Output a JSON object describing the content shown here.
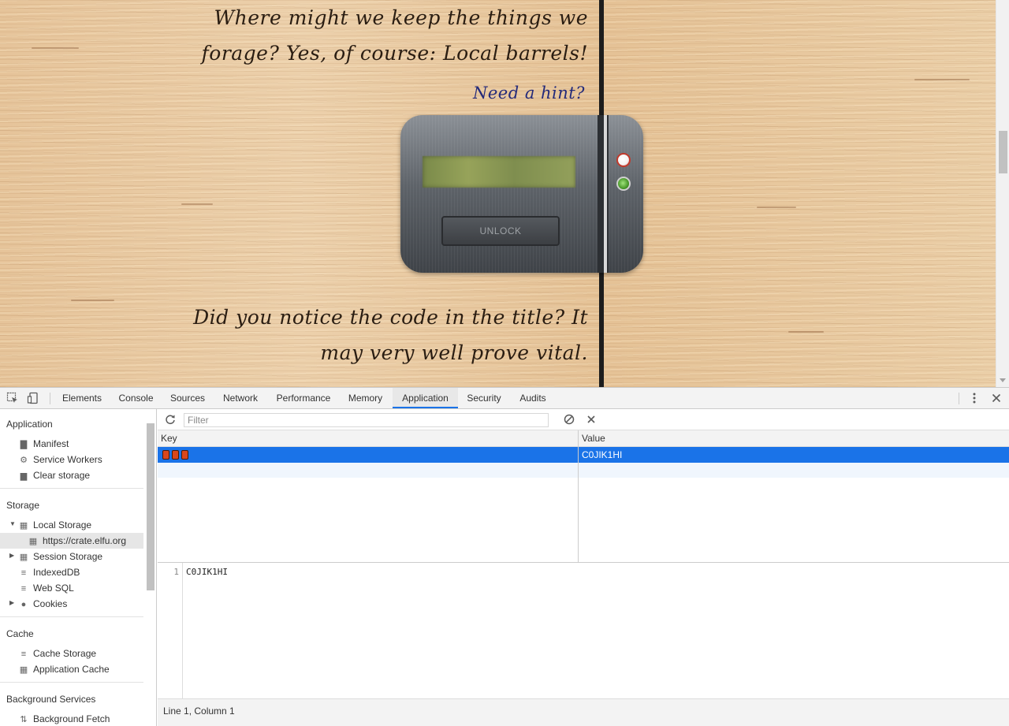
{
  "page": {
    "text_line_1": "Where might we keep the things we",
    "text_line_2": "forage? Yes, of course: Local barrels!",
    "hint_link": "Need a hint?",
    "text_line_3": "Did you notice the code in the title? It",
    "text_line_4": "may very well prove vital.",
    "unlock_button": "UNLOCK"
  },
  "devtools": {
    "tabs": [
      {
        "label": "Elements"
      },
      {
        "label": "Console"
      },
      {
        "label": "Sources"
      },
      {
        "label": "Network"
      },
      {
        "label": "Performance"
      },
      {
        "label": "Memory"
      },
      {
        "label": "Application",
        "active": true
      },
      {
        "label": "Security"
      },
      {
        "label": "Audits"
      }
    ],
    "sidebar": {
      "application_header": "Application",
      "application_items": [
        "Manifest",
        "Service Workers",
        "Clear storage"
      ],
      "storage_header": "Storage",
      "local_storage": "Local Storage",
      "local_storage_origin": "https://crate.elfu.org",
      "session_storage": "Session Storage",
      "indexeddb": "IndexedDB",
      "web_sql": "Web SQL",
      "cookies": "Cookies",
      "cache_header": "Cache",
      "cache_storage": "Cache Storage",
      "application_cache": "Application Cache",
      "background_header": "Background Services",
      "background_fetch": "Background Fetch"
    },
    "storage_view": {
      "filter_placeholder": "Filter",
      "columns": {
        "key": "Key",
        "value": "Value"
      },
      "rows": [
        {
          "key_icon": "barrel-emoji",
          "key_count": 3,
          "value": "C0JIK1HI"
        }
      ],
      "preview": {
        "line_number": "1",
        "text": "C0JIK1HI"
      },
      "status": "Line 1, Column 1"
    },
    "colors": {
      "accent": "#1a73e8",
      "barrel": "#d9471b"
    }
  }
}
